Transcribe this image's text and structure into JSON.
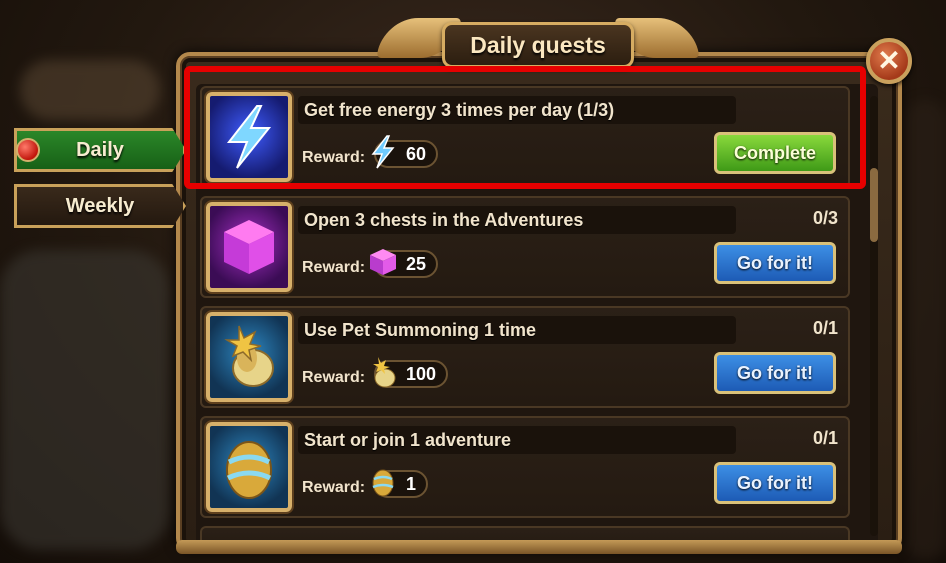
{
  "header": {
    "title": "Daily quests"
  },
  "tabs": [
    {
      "label": "Daily",
      "active": true
    },
    {
      "label": "Weekly",
      "active": false
    }
  ],
  "reward_label": "Reward:",
  "quests": [
    {
      "title": "Get free energy 3 times per day (1/3)",
      "progress": "",
      "reward_icon": "energy-icon",
      "reward_amount": "60",
      "button": "Complete",
      "button_style": "green",
      "icon": "lightning-icon"
    },
    {
      "title": "Open 3 chests in the Adventures",
      "progress": "0/3",
      "reward_icon": "gem-icon",
      "reward_amount": "25",
      "button": "Go for it!",
      "button_style": "blue",
      "icon": "crystal-cube-icon"
    },
    {
      "title": "Use Pet Summoning 1 time",
      "progress": "0/1",
      "reward_icon": "pet-egg-icon",
      "reward_amount": "100",
      "button": "Go for it!",
      "button_style": "blue",
      "icon": "pet-egg-icon"
    },
    {
      "title": "Start or join 1 adventure",
      "progress": "0/1",
      "reward_icon": "egg-icon",
      "reward_amount": "1",
      "button": "Go for it!",
      "button_style": "blue",
      "icon": "golden-egg-icon"
    }
  ],
  "colors": {
    "highlight": "#e60000",
    "complete_button": "#5cb82a",
    "go_button": "#2b73cf",
    "frame_gold": "#c9a15a"
  }
}
